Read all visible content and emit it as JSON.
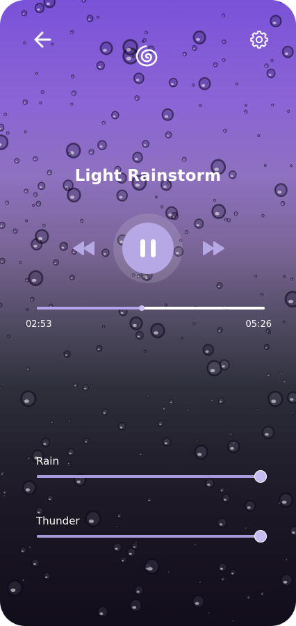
{
  "header": {
    "back_icon": "arrow-left-icon",
    "logo_icon": "spiral-logo-icon",
    "settings_icon": "gear-icon"
  },
  "track": {
    "title": "Light Rainstorm"
  },
  "playback": {
    "state": "playing",
    "rewind_icon": "rewind-icon",
    "pause_icon": "pause-icon",
    "forward_icon": "fast-forward-icon",
    "elapsed": "02:53",
    "duration": "05:26",
    "progress": 0.46
  },
  "mixer": [
    {
      "label": "Rain",
      "level": 1.0
    },
    {
      "label": "Thunder",
      "level": 1.0
    }
  ],
  "colors": {
    "accent": "#b6a8e4",
    "slider_fill": "#a89ad8",
    "text": "#ffffff"
  }
}
